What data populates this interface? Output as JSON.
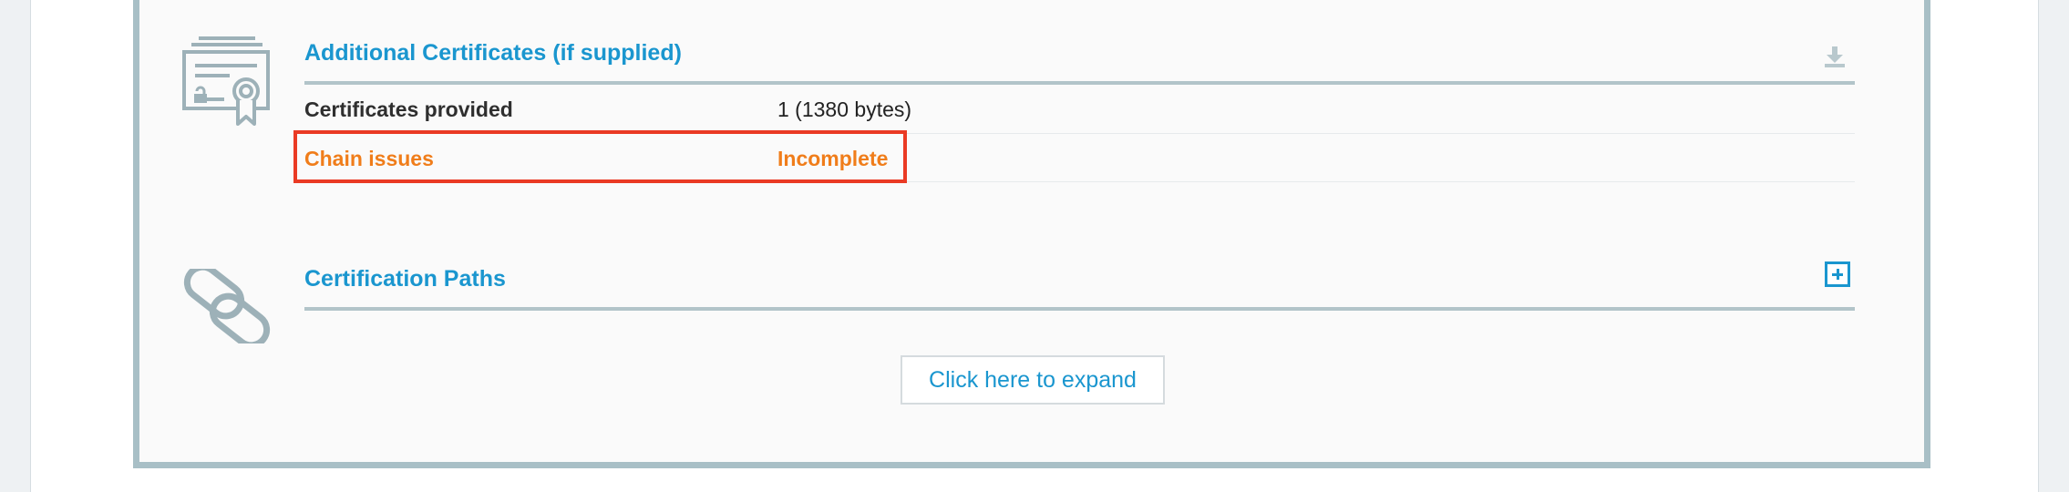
{
  "additional_certificates": {
    "title": "Additional Certificates (if supplied)",
    "icon": "certificate-icon",
    "download_icon": "download-icon",
    "rows": [
      {
        "label": "Certificates provided",
        "value": "1 (1380 bytes)"
      },
      {
        "label": "Chain issues",
        "value": "Incomplete",
        "status": "warning"
      }
    ]
  },
  "certification_paths": {
    "title": "Certification Paths",
    "icon": "chain-link-icon",
    "toggle_icon": "plus-box-icon",
    "expand_label": "Click here to expand"
  },
  "colors": {
    "accent": "#1a96cf",
    "warning": "#f07d1a",
    "highlight_border": "#ea3a24",
    "frame": "#a8bfc6"
  }
}
